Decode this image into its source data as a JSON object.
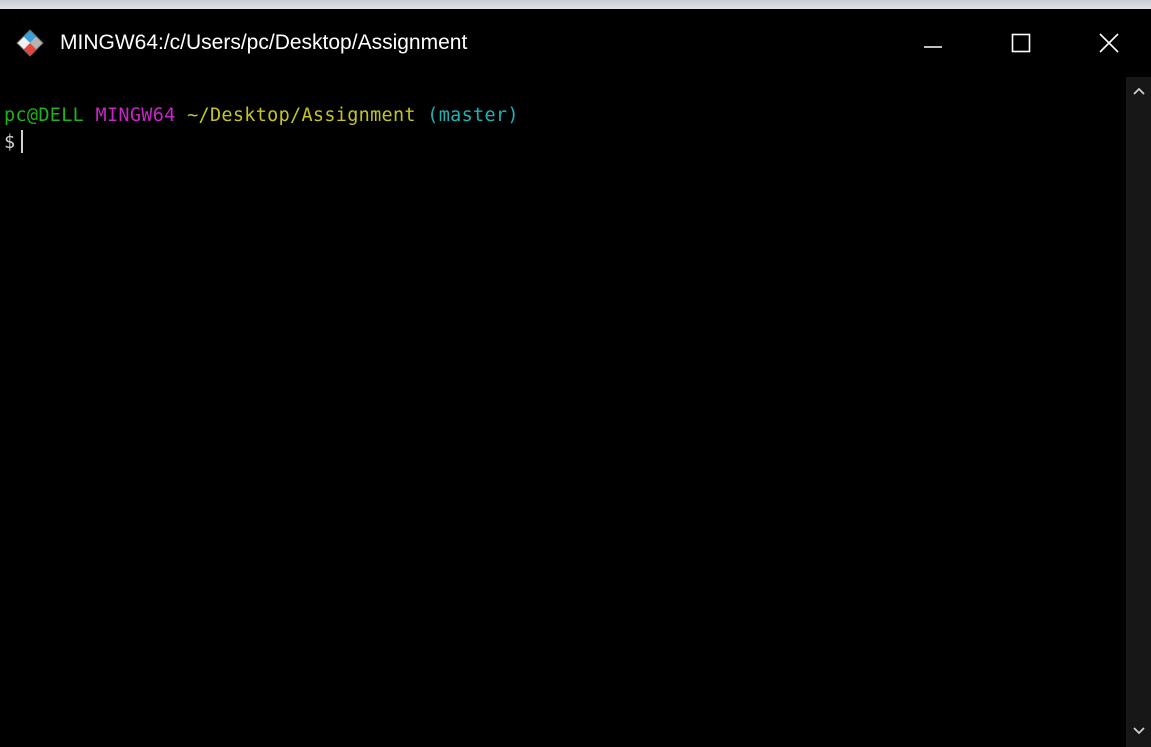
{
  "window": {
    "title": "MINGW64:/c/Users/pc/Desktop/Assignment"
  },
  "icons": {
    "app": "git-bash-icon",
    "minimize": "minimize-icon",
    "maximize": "maximize-icon",
    "close": "close-icon",
    "scroll_up": "chevron-up-icon",
    "scroll_down": "chevron-down-icon"
  },
  "terminal": {
    "prompt": {
      "user_host": "pc@DELL",
      "system": "MINGW64",
      "path": "~/Desktop/Assignment",
      "branch": "(master)",
      "symbol": "$"
    }
  },
  "colors": {
    "background": "#000000",
    "title_text": "#ffffff",
    "user_host": "#1db31d",
    "system": "#c526c5",
    "path": "#c4c424",
    "branch": "#20b2b2",
    "prompt_symbol": "#d0d0d0",
    "cursor": "#d0d0d0"
  }
}
